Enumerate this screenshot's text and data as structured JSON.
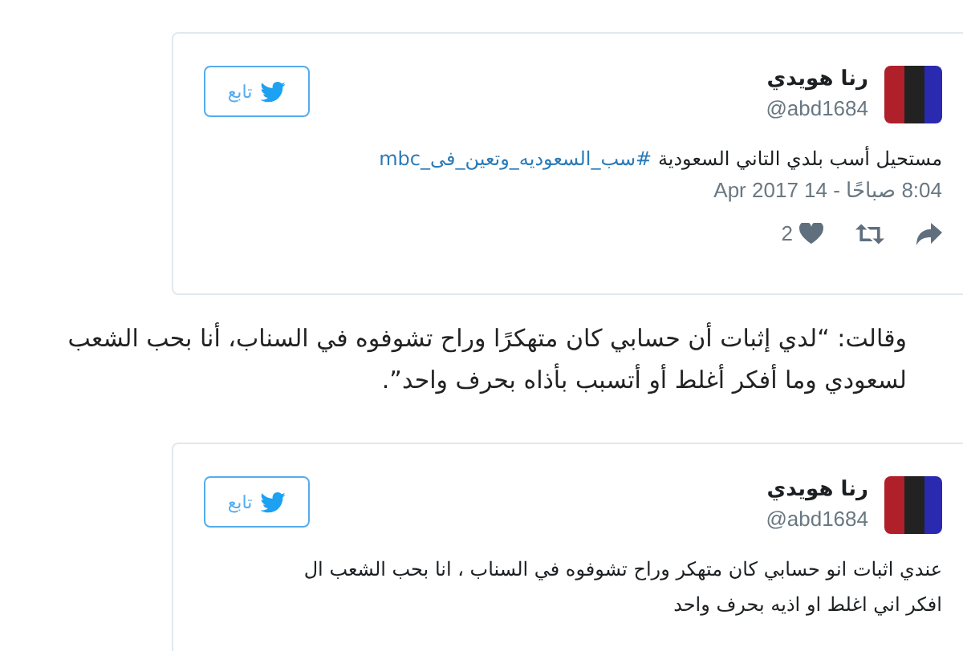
{
  "tweets": [
    {
      "name": "رنا هويدي",
      "handle": "@abd1684",
      "follow_label": "تابع",
      "lines": [
        [
          {
            "kind": "plain",
            "text": "مستحيل أسب بلدي التاني السعودية "
          },
          {
            "kind": "hashtag",
            "text": "#سب_السعوديه_وتعين_فى_mbc"
          }
        ]
      ],
      "date": "8:04 صباحًا - 14 Apr 2017",
      "likes": "2"
    },
    {
      "name": "رنا هويدي",
      "handle": "@abd1684",
      "follow_label": "تابع",
      "lines": [
        [
          {
            "kind": "plain",
            "text": "عندي اثبات انو حسابي كان متهكر وراح تشوفوه في السناب ، انا بحب الشعب ال"
          }
        ],
        [
          {
            "kind": "plain",
            "text": "افكر اني اغلط او اذيه بحرف واحد"
          }
        ]
      ]
    }
  ],
  "paragraph": [
    "وقالت: “لدي إثبات أن حسابي كان متهكرًا وراح تشوفوه في السناب، أنا بحب الشعب",
    "لسعودي وما أفكر أغلط  أو أتسبب بأذاه بحرف واحد”."
  ]
}
